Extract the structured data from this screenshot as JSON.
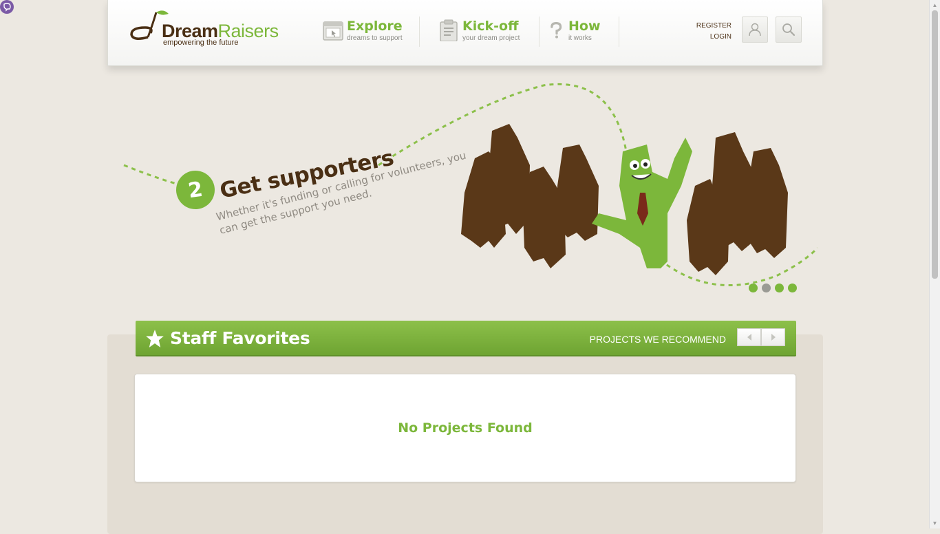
{
  "brand": {
    "name_part1": "Dream",
    "name_part2": "Raisers",
    "tagline": "empowering the future",
    "green": "#7cb73b",
    "brown": "#4a2f14"
  },
  "nav": [
    {
      "title": "Explore",
      "sub": "dreams to support",
      "icon": "browser-window-icon"
    },
    {
      "title": "Kick-off",
      "sub": "your dream project",
      "icon": "clipboard-icon"
    },
    {
      "title": "How",
      "sub": "it works",
      "icon": "question-mark-icon"
    }
  ],
  "auth": {
    "register": "REGISTER",
    "login": "LOGIN"
  },
  "header_buttons": {
    "user": "user-icon",
    "search": "search-icon"
  },
  "hero": {
    "step_number": "2",
    "step_title": "Get supporters",
    "step_desc": "Whether it's funding or calling for volunteers, you can get the support you need.",
    "slide_dots": 4,
    "active_dot": 2
  },
  "staff_favorites": {
    "title": "Staff Favorites",
    "recommend_label": "PROJECTS WE RECOMMEND",
    "empty_message": "No Projects Found"
  }
}
